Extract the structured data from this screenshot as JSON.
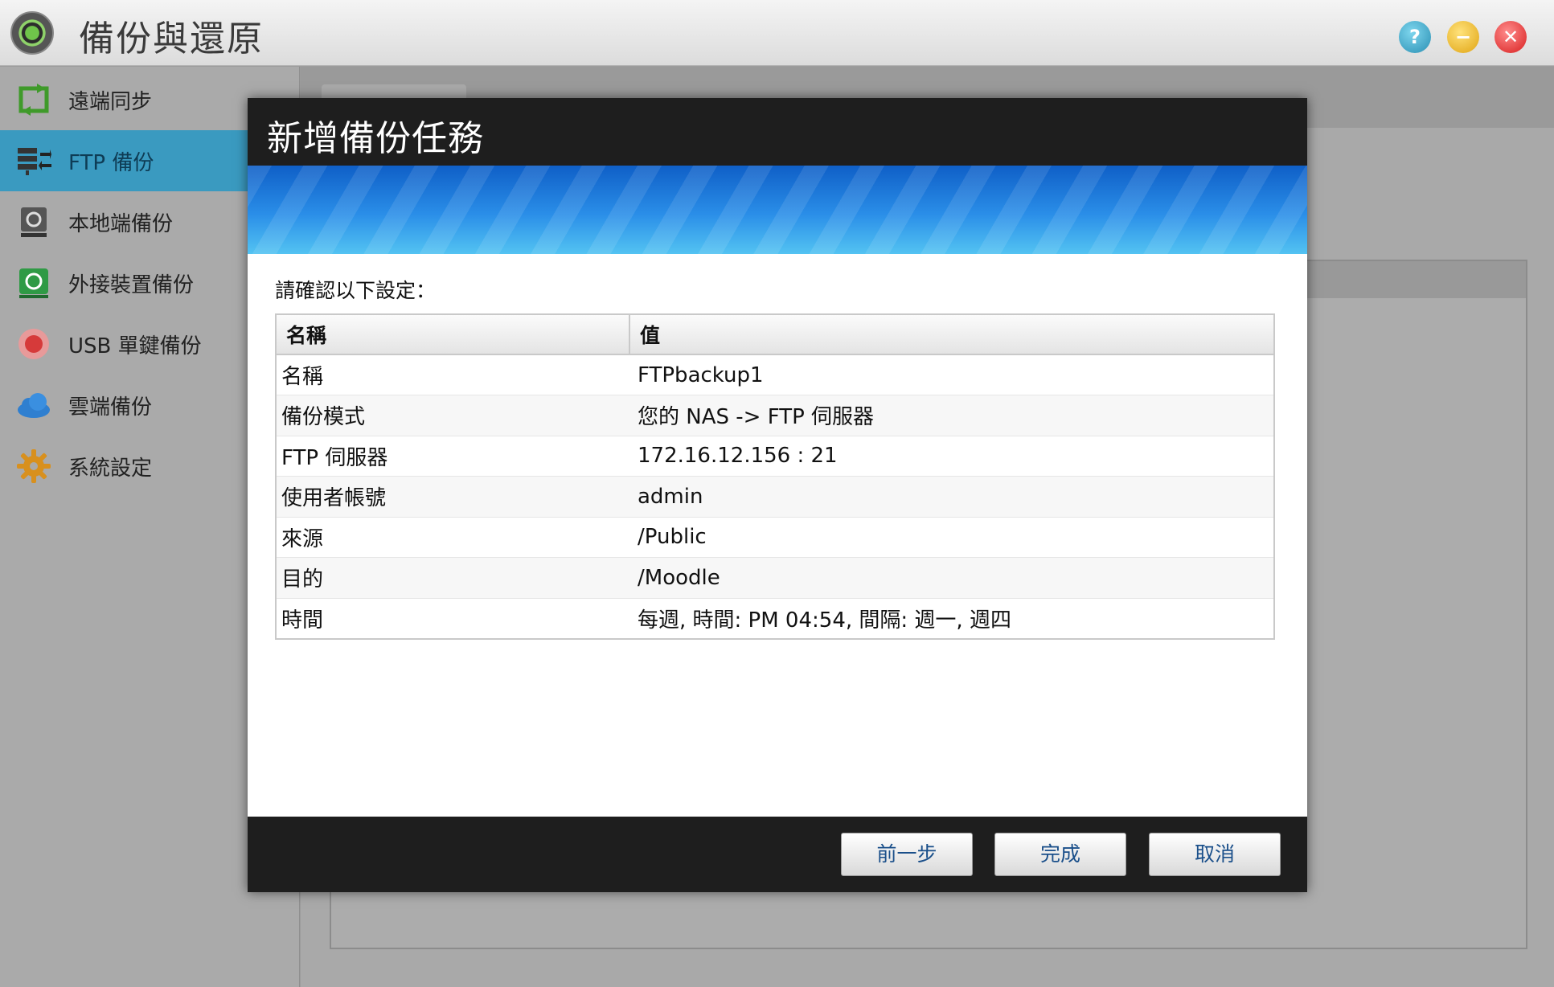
{
  "app": {
    "title": "備份與還原"
  },
  "sidebar": {
    "items": [
      {
        "label": "遠端同步",
        "icon": "remote-sync-icon"
      },
      {
        "label": "FTP 備份",
        "icon": "ftp-backup-icon",
        "active": true
      },
      {
        "label": "本地端備份",
        "icon": "local-backup-icon"
      },
      {
        "label": "外接裝置備份",
        "icon": "external-device-icon"
      },
      {
        "label": "USB 單鍵備份",
        "icon": "usb-one-touch-icon"
      },
      {
        "label": "雲端備份",
        "icon": "cloud-icon"
      },
      {
        "label": "系統設定",
        "icon": "gear-icon"
      }
    ]
  },
  "dialog": {
    "title": "新增備份任務",
    "prompt": "請確認以下設定：",
    "table": {
      "headers": [
        "名稱",
        "值"
      ],
      "rows": [
        [
          "名稱",
          "FTPbackup1"
        ],
        [
          "備份模式",
          "您的 NAS -> FTP 伺服器"
        ],
        [
          "FTP 伺服器",
          "172.16.12.156 : 21"
        ],
        [
          "使用者帳號",
          "admin"
        ],
        [
          "來源",
          "/Public"
        ],
        [
          "目的",
          "/Moodle"
        ],
        [
          "時間",
          "每週, 時間: PM 04:54, 間隔: 週一, 週四"
        ]
      ]
    },
    "buttons": {
      "prev": "前一步",
      "finish": "完成",
      "cancel": "取消"
    }
  },
  "colors": {
    "accent": "#3a9ac0",
    "dialog_header": "#1e1e1e",
    "button_text": "#1a4f8a"
  }
}
